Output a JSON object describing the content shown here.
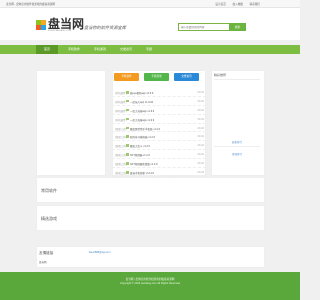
{
  "topbar": {
    "notice": "盘当网 - 盘你应用软件和游戏的极客资源网",
    "links": [
      "设为首页",
      "加入收藏",
      "联系我们"
    ]
  },
  "logo": {
    "name": "盘当网",
    "domain": "WWW.PANDANG.COM"
  },
  "slogan": "盘当你的软件资源宝库",
  "search": {
    "placeholder": "输入您要搜索的内容",
    "button": "搜索"
  },
  "nav": {
    "items": [
      "首页",
      "手机软件",
      "手机游戏",
      "文章资讯",
      "专题"
    ]
  },
  "categories": [
    "手机软件",
    "手机游戏",
    "文章资讯"
  ],
  "list": [
    {
      "cat": "[手机软件]",
      "title": "微eye相机app v2.5.9",
      "date": "09-02"
    },
    {
      "cat": "[手机软件]",
      "title": "一起玩大app v1.9.93",
      "date": "09-02"
    },
    {
      "cat": "[手机软件]",
      "title": "一起大海报app v1.9.9",
      "date": "09-02"
    },
    {
      "cat": "[手机软件]",
      "title": "一起大海报app v1.9.9",
      "date": "09-02"
    },
    {
      "cat": "[游戏工具]",
      "title": "魔鬼医院猎手手机版 v1.2.6",
      "date": "09-02"
    },
    {
      "cat": "[游戏工具]",
      "title": "陪你练习模拟器 v1.2.6",
      "date": "09-02"
    },
    {
      "cat": "[游戏工具]",
      "title": "魔鬼大乱斗 v1.2.0",
      "date": "09-02"
    },
    {
      "cat": "[游戏工具]",
      "title": "NFT管理器 v1.2.6",
      "date": "09-02"
    },
    {
      "cat": "[游戏工具]",
      "title": "NFT管理器免费版 v1.0.9",
      "date": "09-02"
    },
    {
      "cat": "[游戏工具]",
      "title": "盘当手机管家 v3.4.19",
      "date": "09-02"
    }
  ],
  "right": {
    "title": "精彩推荐",
    "items": [
      "装机排行",
      "游戏排行"
    ]
  },
  "sections": [
    "常用软件",
    "精选游戏"
  ],
  "friend": {
    "label": "友情链接",
    "email": "lianxi888@qq.com",
    "link": "盘当网"
  },
  "footer": {
    "line1": "盘当网 | 盘你应用软件和游戏的极客资源网",
    "line2": "Copyright © 2023 pandang.com All Rights Reserved"
  }
}
